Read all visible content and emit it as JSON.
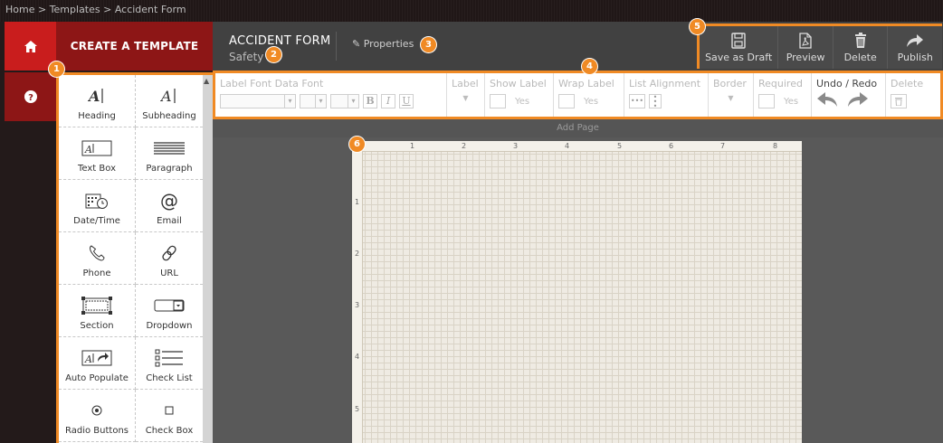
{
  "breadcrumb": "Home > Templates > Accident Form",
  "rail": {
    "home_icon": "home-icon",
    "help_icon": "question-icon"
  },
  "create_banner": "CREATE A TEMPLATE",
  "palette": {
    "items": [
      {
        "label": "Heading",
        "icon": "heading-icon"
      },
      {
        "label": "Subheading",
        "icon": "subheading-icon"
      },
      {
        "label": "Text Box",
        "icon": "textbox-icon"
      },
      {
        "label": "Paragraph",
        "icon": "paragraph-icon"
      },
      {
        "label": "Date/Time",
        "icon": "datetime-icon"
      },
      {
        "label": "Email",
        "icon": "email-icon"
      },
      {
        "label": "Phone",
        "icon": "phone-icon"
      },
      {
        "label": "URL",
        "icon": "link-icon"
      },
      {
        "label": "Section",
        "icon": "section-icon"
      },
      {
        "label": "Dropdown",
        "icon": "dropdown-icon"
      },
      {
        "label": "Auto Populate",
        "icon": "autopopulate-icon"
      },
      {
        "label": "Check List",
        "icon": "checklist-icon"
      },
      {
        "label": "Radio Buttons",
        "icon": "radio-icon"
      },
      {
        "label": "Check Box",
        "icon": "checkbox-icon"
      }
    ]
  },
  "header": {
    "title": "ACCIDENT FORM",
    "subtitle": "Safety",
    "properties_label": "Properties"
  },
  "actions": [
    {
      "label": "Save as Draft",
      "icon": "floppy-icon"
    },
    {
      "label": "Preview",
      "icon": "pdf-icon"
    },
    {
      "label": "Delete",
      "icon": "trash-icon"
    },
    {
      "label": "Publish",
      "icon": "share-icon"
    }
  ],
  "toolbar": {
    "label_font": "Label Font",
    "data_font": "Data Font",
    "bold": "B",
    "italic": "I",
    "underline": "U",
    "label": "Label",
    "show_label": "Show Label",
    "show_label_yes": "Yes",
    "wrap_label": "Wrap Label",
    "wrap_label_yes": "Yes",
    "list_alignment": "List Alignment",
    "border": "Border",
    "required": "Required",
    "required_yes": "Yes",
    "undo_redo": "Undo / Redo",
    "delete": "Delete"
  },
  "add_page": "Add Page",
  "ruler": {
    "top": [
      "1",
      "2",
      "3",
      "4",
      "5",
      "6",
      "7",
      "8"
    ],
    "left": [
      "1",
      "2",
      "3",
      "4",
      "5"
    ]
  },
  "badges": [
    "1",
    "2",
    "3",
    "4",
    "5",
    "6"
  ],
  "colors": {
    "accent": "#f08a24",
    "brand_red": "#8d1616",
    "header": "#414141"
  }
}
